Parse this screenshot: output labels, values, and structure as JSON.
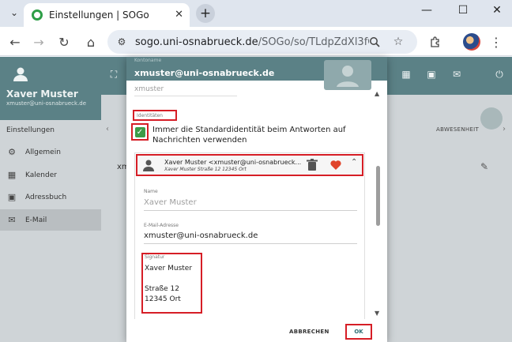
{
  "browser": {
    "tab_title": "Einstellungen | SOGo",
    "tab_close": "✕",
    "new_tab": "+",
    "url_host": "sogo.uni-osnabrueck.de",
    "url_path": "/SOGo/so/TLdpZdXl3fQ...",
    "minimize": "—",
    "maximize": "☐",
    "close": "✕"
  },
  "app": {
    "user_name": "Xaver Muster",
    "user_email": "xmuster@uni-osnabrueck.de",
    "nav_title": "Einstellungen",
    "nav_items": [
      {
        "label": "Allgemein",
        "icon": "gear-icon"
      },
      {
        "label": "Kalender",
        "icon": "calendar-icon"
      },
      {
        "label": "Adressbuch",
        "icon": "contacts-icon"
      },
      {
        "label": "E-Mail",
        "icon": "mail-icon"
      }
    ],
    "tabs": {
      "right": "ABWESENHEIT"
    },
    "stub_text": "xm"
  },
  "dialog": {
    "account_label": "Kontoname",
    "account_value": "xmuster@uni-osnabrueck.de",
    "faded_email": "xmuster",
    "identities_label": "Identitäten",
    "checkbox_label": "Immer die Standardidentität beim Antworten auf Nachrichten verwenden",
    "checkbox_checked": true,
    "identity": {
      "line1": "Xaver Muster   <xmuster@uni-osnabrueck...",
      "line2": "Xaver Muster Straße 12 12345 Ort"
    },
    "name_label": "Name",
    "name_placeholder": "Xaver Muster",
    "email_label": "E-Mail-Adresse",
    "email_value": "xmuster@uni-osnabrueck.de",
    "signature_label": "Signatur",
    "signature_text": "Xaver Muster\n\nStraße 12\n12345 Ort",
    "cancel_label": "ABBRECHEN",
    "ok_label": "OK"
  },
  "colors": {
    "header": "#5b8186",
    "highlight": "#d61e26",
    "check": "#3d9b47",
    "heart": "#e0442b"
  }
}
